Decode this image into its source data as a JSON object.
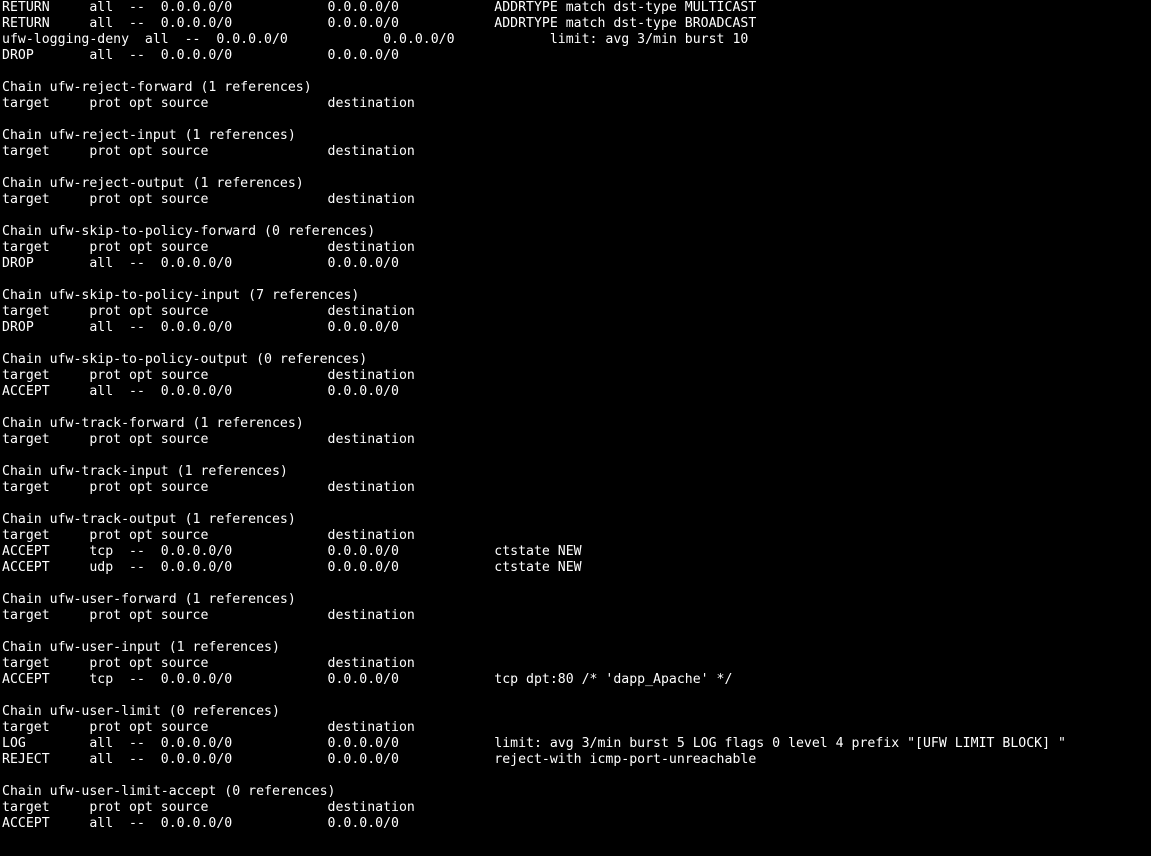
{
  "terminal": {
    "lines": [
      "RETURN     all  --  0.0.0.0/0            0.0.0.0/0            ADDRTYPE match dst-type MULTICAST",
      "RETURN     all  --  0.0.0.0/0            0.0.0.0/0            ADDRTYPE match dst-type BROADCAST",
      "ufw-logging-deny  all  --  0.0.0.0/0            0.0.0.0/0            limit: avg 3/min burst 10",
      "DROP       all  --  0.0.0.0/0            0.0.0.0/0",
      "",
      "Chain ufw-reject-forward (1 references)",
      "target     prot opt source               destination",
      "",
      "Chain ufw-reject-input (1 references)",
      "target     prot opt source               destination",
      "",
      "Chain ufw-reject-output (1 references)",
      "target     prot opt source               destination",
      "",
      "Chain ufw-skip-to-policy-forward (0 references)",
      "target     prot opt source               destination",
      "DROP       all  --  0.0.0.0/0            0.0.0.0/0",
      "",
      "Chain ufw-skip-to-policy-input (7 references)",
      "target     prot opt source               destination",
      "DROP       all  --  0.0.0.0/0            0.0.0.0/0",
      "",
      "Chain ufw-skip-to-policy-output (0 references)",
      "target     prot opt source               destination",
      "ACCEPT     all  --  0.0.0.0/0            0.0.0.0/0",
      "",
      "Chain ufw-track-forward (1 references)",
      "target     prot opt source               destination",
      "",
      "Chain ufw-track-input (1 references)",
      "target     prot opt source               destination",
      "",
      "Chain ufw-track-output (1 references)",
      "target     prot opt source               destination",
      "ACCEPT     tcp  --  0.0.0.0/0            0.0.0.0/0            ctstate NEW",
      "ACCEPT     udp  --  0.0.0.0/0            0.0.0.0/0            ctstate NEW",
      "",
      "Chain ufw-user-forward (1 references)",
      "target     prot opt source               destination",
      "",
      "Chain ufw-user-input (1 references)",
      "target     prot opt source               destination",
      "ACCEPT     tcp  --  0.0.0.0/0            0.0.0.0/0            tcp dpt:80 /* 'dapp_Apache' */",
      "",
      "Chain ufw-user-limit (0 references)",
      "target     prot opt source               destination",
      "LOG        all  --  0.0.0.0/0            0.0.0.0/0            limit: avg 3/min burst 5 LOG flags 0 level 4 prefix \"[UFW LIMIT BLOCK] \"",
      "REJECT     all  --  0.0.0.0/0            0.0.0.0/0            reject-with icmp-port-unreachable",
      "",
      "Chain ufw-user-limit-accept (0 references)",
      "target     prot opt source               destination",
      "ACCEPT     all  --  0.0.0.0/0            0.0.0.0/0",
      ""
    ]
  }
}
